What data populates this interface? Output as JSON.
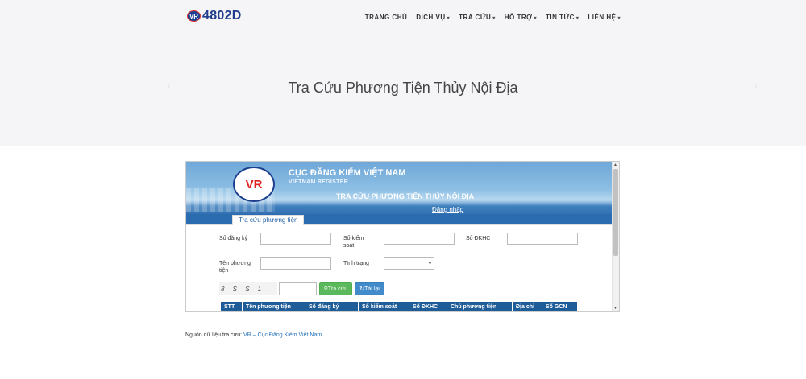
{
  "brand": {
    "logo_text": "4802D",
    "logo_badge": "VR"
  },
  "nav": [
    {
      "label": "TRANG CHỦ",
      "dropdown": false
    },
    {
      "label": "DỊCH VỤ",
      "dropdown": true
    },
    {
      "label": "TRA CỨU",
      "dropdown": true
    },
    {
      "label": "HỖ TRỢ",
      "dropdown": true
    },
    {
      "label": "TIN TỨC",
      "dropdown": true
    },
    {
      "label": "LIÊN HỆ",
      "dropdown": true
    }
  ],
  "hero": {
    "title": "Tra Cứu Phương Tiện Thủy Nội Địa"
  },
  "embed": {
    "agency_name": "CỤC ĐĂNG KIỂM VIỆT NAM",
    "agency_name_en": "VIETNAM REGISTER",
    "page_title": "TRA CỨU PHƯƠNG TIỆN THỦY NỘI ĐỊA",
    "login_link": "Đăng nhập",
    "seal_text": "VR",
    "tab_label": "Tra cứu phương tiện",
    "form": {
      "so_dang_ky": {
        "label": "Số đăng ký",
        "value": ""
      },
      "so_kiem_soat": {
        "label": "Số kiểm soát",
        "value": ""
      },
      "so_dkhc": {
        "label": "Số ĐKHC",
        "value": ""
      },
      "ten_phuong_tien": {
        "label": "Tên phương tiện",
        "value": ""
      },
      "tinh_trang": {
        "label": "Tình trạng",
        "value": ""
      },
      "captcha_value": ""
    },
    "captcha_text": "8 S S 1",
    "buttons": {
      "search": "Tra cứu",
      "reload": "Tải lại"
    },
    "table_headers": [
      "STT",
      "Tên phương tiện",
      "Số đăng ký",
      "Số kiểm soát",
      "Số ĐKHC",
      "Chủ phương tiện",
      "Địa chỉ",
      "Số GCN"
    ]
  },
  "footer": {
    "source_label": "Nguồn dữ liệu tra cứu:",
    "source_link": "VR – Cục Đăng Kiểm Việt Nam"
  },
  "colors": {
    "brand": "#1f3d8c",
    "table_header": "#1f5d99",
    "link": "#1f6fb5",
    "search_button": "#5cb85c",
    "reload_button": "#428bca"
  }
}
